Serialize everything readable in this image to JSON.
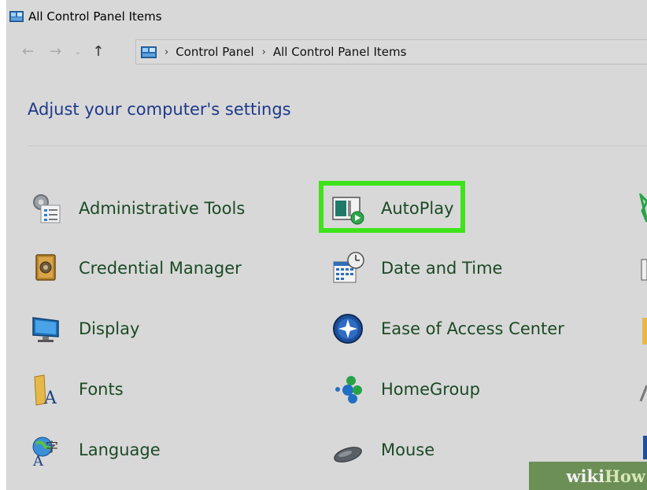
{
  "window": {
    "title": "All Control Panel Items"
  },
  "navigation": {
    "back": "←",
    "forward": "→",
    "recent": "⌄",
    "up": "↑"
  },
  "breadcrumb": [
    "Control Panel",
    "All Control Panel Items"
  ],
  "breadcrumb_separator": "›",
  "page": {
    "heading": "Adjust your computer's settings"
  },
  "items": {
    "col1": [
      {
        "label": "Administrative Tools",
        "icon": "admin-tools-icon"
      },
      {
        "label": "Credential Manager",
        "icon": "credential-manager-icon"
      },
      {
        "label": "Display",
        "icon": "display-icon"
      },
      {
        "label": "Fonts",
        "icon": "fonts-icon"
      },
      {
        "label": "Language",
        "icon": "language-icon"
      }
    ],
    "col2": [
      {
        "label": "AutoPlay",
        "icon": "autoplay-icon",
        "highlighted": true
      },
      {
        "label": "Date and Time",
        "icon": "date-time-icon"
      },
      {
        "label": "Ease of Access Center",
        "icon": "ease-of-access-icon"
      },
      {
        "label": "HomeGroup",
        "icon": "homegroup-icon"
      },
      {
        "label": "Mouse",
        "icon": "mouse-icon"
      }
    ]
  },
  "watermark": {
    "part1": "wiki",
    "part2": "How"
  },
  "colors": {
    "highlight": "#3ee31b",
    "heading": "#1e3a8a",
    "item_text": "#1b4a25",
    "background": "#d8d8d8"
  }
}
